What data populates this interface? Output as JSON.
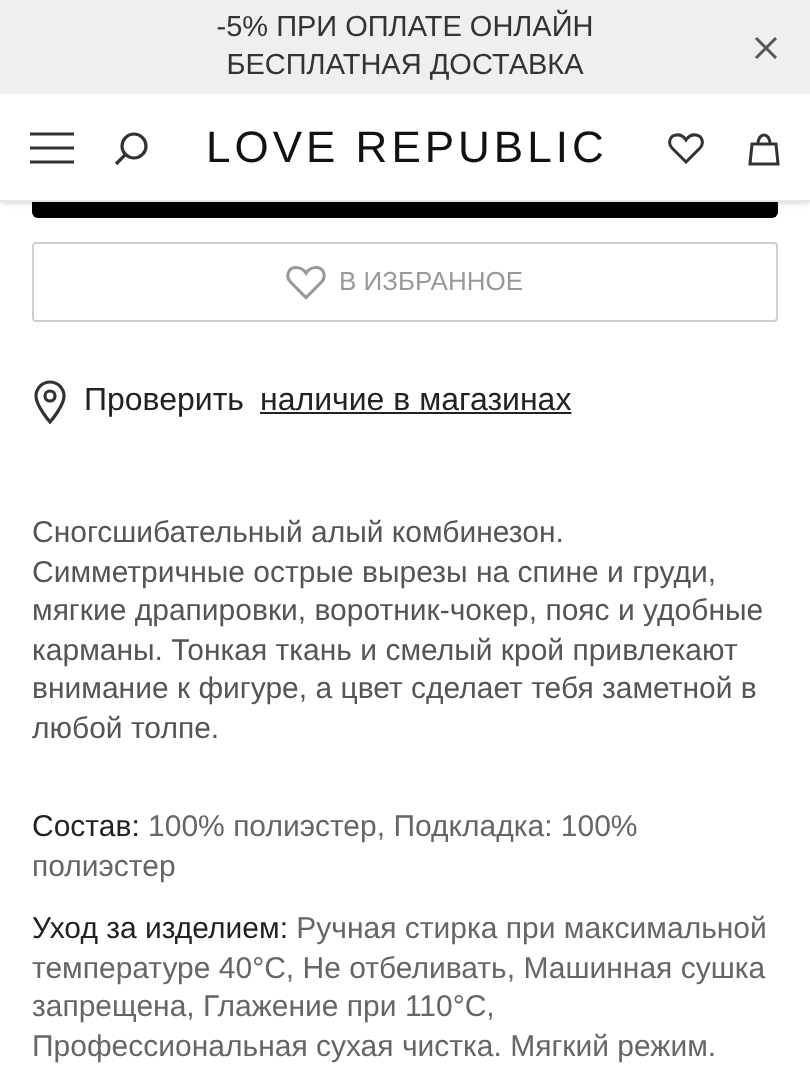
{
  "promo_banner": {
    "lines": [
      "-5% ПРИ ОПЛАТЕ ОНЛАЙН",
      "БЕСПЛАТНАЯ ДОСТАВКА"
    ]
  },
  "header": {
    "logo": "LOVE REPUBLIC"
  },
  "favorite_button": {
    "label": "В ИЗБРАННОЕ"
  },
  "store_check": {
    "text": "Проверить",
    "link": "наличие в магазинах"
  },
  "description": "Сногсшибательный алый комбинезон. Симметричные острые вырезы на спине и груди, мягкие драпировки, воротник-чокер, пояс и удобные карманы. Тонкая ткань и смелый крой привлекают внимание к фигуре, а цвет сделает тебя заметной в любой толпе.",
  "details": [
    {
      "label": "Состав:",
      "value": "100% полиэстер, Подкладка: 100% полиэстер"
    },
    {
      "label": "Уход за изделием:",
      "value": "Ручная стирка при максимальной температуре 40°C, Не отбеливать, Машинная сушка запрещена, Глажение при 110°C, Профессиональная сухая чистка. Мягкий режим."
    }
  ]
}
